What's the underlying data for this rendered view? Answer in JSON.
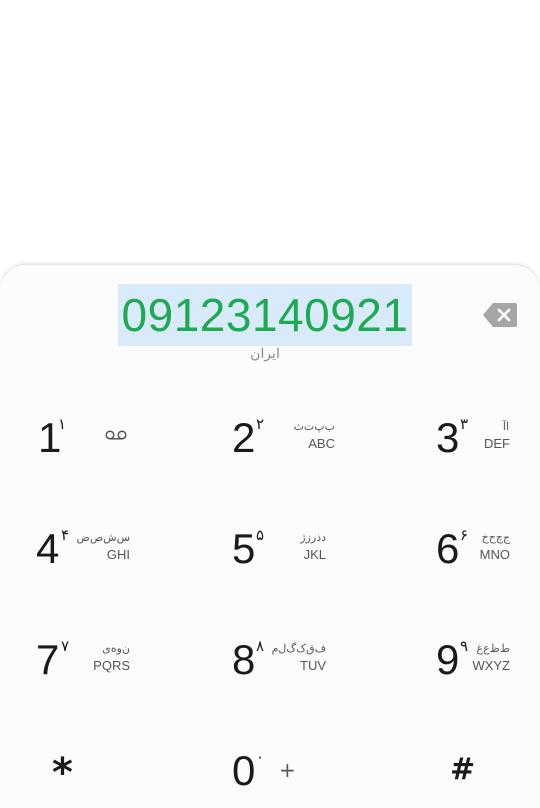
{
  "dialer": {
    "number": "09123140921",
    "country": "ایران",
    "number_color": "#1daa52",
    "selection_color": "#d9ebfb"
  },
  "backspace": {
    "icon": "backspace-icon"
  },
  "keys": [
    {
      "digit": "1",
      "persian_digit": "۱",
      "persian": "",
      "letters": "",
      "icon": "voicemail-icon"
    },
    {
      "digit": "2",
      "persian_digit": "۲",
      "persian": "ب‌پ‌ت‌ث",
      "letters": "ABC"
    },
    {
      "digit": "3",
      "persian_digit": "۳",
      "persian": "ا‌آ",
      "letters": "DEF"
    },
    {
      "digit": "4",
      "persian_digit": "۴",
      "persian": "س‌ش‌ص‌ض",
      "letters": "GHI"
    },
    {
      "digit": "5",
      "persian_digit": "۵",
      "persian": "د‌ذ‌ر‌ز‌ژ",
      "letters": "JKL"
    },
    {
      "digit": "6",
      "persian_digit": "۶",
      "persian": "ج‌چ‌ح‌خ",
      "letters": "MNO"
    },
    {
      "digit": "7",
      "persian_digit": "۷",
      "persian": "ن‌و‌ه‌ی",
      "letters": "PQRS"
    },
    {
      "digit": "8",
      "persian_digit": "۸",
      "persian": "ف‌ق‌ک‌گ‌ل‌م",
      "letters": "TUV"
    },
    {
      "digit": "9",
      "persian_digit": "۹",
      "persian": "ط‌ظ‌ع‌غ",
      "letters": "WXYZ"
    },
    {
      "digit": "*"
    },
    {
      "digit": "0",
      "persian_digit": "۰",
      "letters": "+"
    },
    {
      "digit": "#"
    }
  ]
}
